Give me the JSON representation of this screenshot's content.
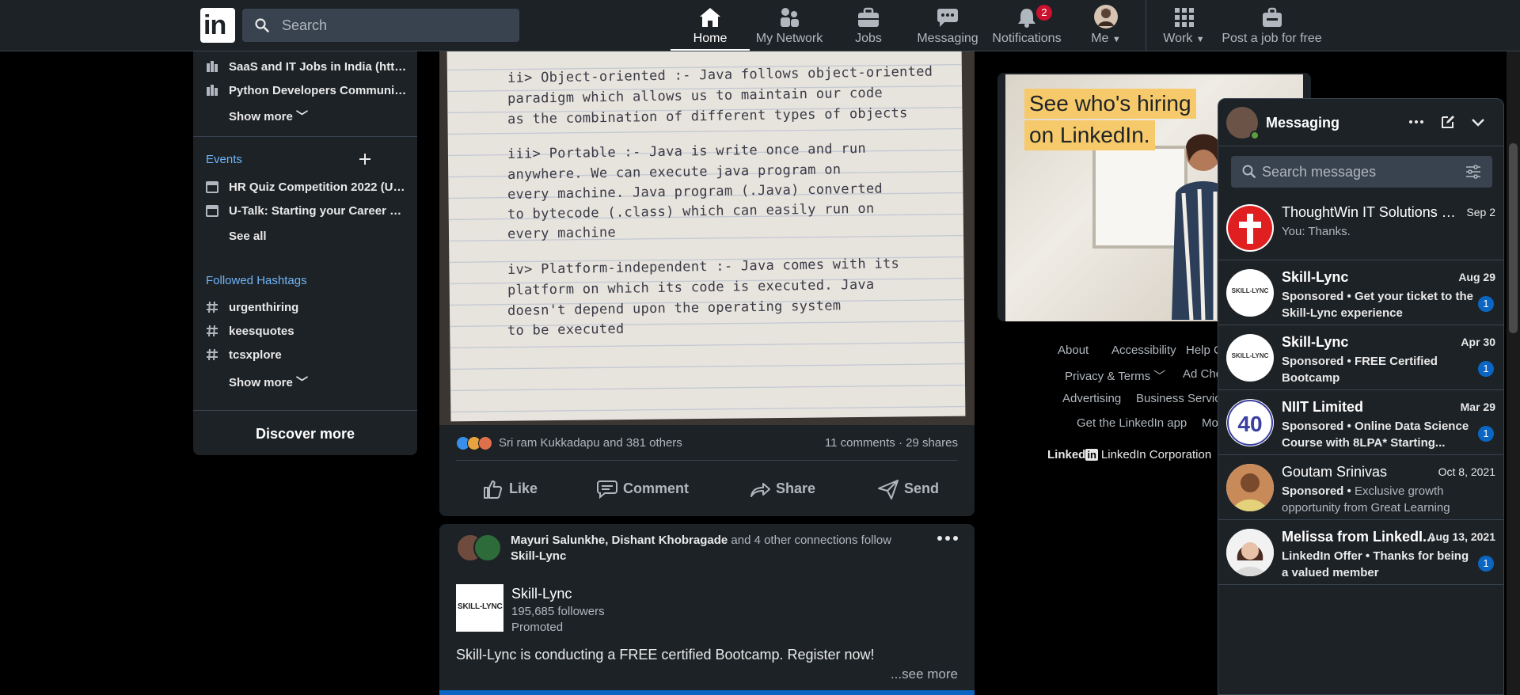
{
  "nav": {
    "logo_text": "in",
    "search_placeholder": "Search",
    "items": [
      {
        "label": "Home",
        "icon": "home-icon"
      },
      {
        "label": "My Network",
        "icon": "network-icon"
      },
      {
        "label": "Jobs",
        "icon": "briefcase-icon"
      },
      {
        "label": "Messaging",
        "icon": "chat-icon"
      },
      {
        "label": "Notifications",
        "icon": "bell-icon",
        "badge": "2"
      },
      {
        "label": "Me",
        "icon": "avatar"
      },
      {
        "label": "Work",
        "icon": "grid-icon"
      },
      {
        "label": "Post a job for free",
        "icon": "post-job-icon"
      }
    ]
  },
  "sidebar": {
    "groups": [
      {
        "label": "SaaS and IT Jobs in India (http..."
      },
      {
        "label": "Python Developers Communit..."
      }
    ],
    "groups_show_more": "Show more",
    "events_heading": "Events",
    "events": [
      {
        "label": "HR Quiz Competition 2022 (Us..."
      },
      {
        "label": "U-Talk: Starting your Career at ..."
      }
    ],
    "events_see_all": "See all",
    "hashtags_heading": "Followed Hashtags",
    "hashtags": [
      {
        "label": "urgenthiring"
      },
      {
        "label": "keesquotes"
      },
      {
        "label": "tcsxplore"
      }
    ],
    "hashtags_show_more": "Show more",
    "discover": "Discover more"
  },
  "post1": {
    "note_lines": [
      "ii> Object-oriented :- Java follows object-oriented",
      "paradigm which allows us to maintain our code",
      "as the combination of different types of objects",
      "iii> Portable :- Java is write once and run",
      "anywhere. We can execute java program on",
      "every machine. Java program (.Java) converted",
      "to bytecode (.class) which can easily run on",
      "every machine",
      "iv> Platform-independent :- Java comes with its",
      "platform on which its code is executed. Java",
      "doesn't depend upon the operating system",
      "to be executed"
    ],
    "reactions_text": "Sri ram Kukkadapu and 381 others",
    "stats_text": "11 comments · 29 shares",
    "actions": {
      "like": "Like",
      "comment": "Comment",
      "share": "Share",
      "send": "Send"
    }
  },
  "post2": {
    "connection_names": "Mayuri Salunkhe, Dishant Khobragade",
    "connection_rest": " and 4 other connections follow",
    "connection_company": "Skill-Lync",
    "logo_text": "SKILL-LYNC",
    "company": "Skill-Lync",
    "followers": "195,685 followers",
    "promoted": "Promoted",
    "text": "Skill-Lync is conducting a FREE certified Bootcamp. Register now!",
    "see_more": "...see more"
  },
  "ad": {
    "line1": "See who's hiring",
    "line2": "on LinkedIn."
  },
  "footer": {
    "links": [
      "About",
      "Accessibility",
      "Help C",
      "Privacy & Terms",
      "Ad Cho",
      "Advertising",
      "Business Service",
      "Get the LinkedIn app",
      "Mo"
    ],
    "brand_word": "Linked",
    "brand_in": "in",
    "corp": "LinkedIn Corporation"
  },
  "messaging": {
    "title": "Messaging",
    "search_placeholder": "Search messages",
    "conversations": [
      {
        "name": "ThoughtWin IT Solutions Pv...",
        "date": "Sep 2",
        "preview": "You: Thanks.",
        "sponsored": "",
        "unread": "",
        "bold": false
      },
      {
        "name": "Skill-Lync",
        "date": "Aug 29",
        "sponsored": "Sponsored •",
        "preview": "Get your ticket to the Skill-Lync experience",
        "unread": "1",
        "bold": true
      },
      {
        "name": "Skill-Lync",
        "date": "Apr 30",
        "sponsored": "Sponsored •",
        "preview": "FREE Certified Bootcamp",
        "unread": "1",
        "bold": true
      },
      {
        "name": "NIIT Limited",
        "date": "Mar 29",
        "sponsored": "Sponsored •",
        "preview": "Online Data Science Course with 8LPA* Starting...",
        "unread": "1",
        "bold": true
      },
      {
        "name": "Goutam Srinivas",
        "date": "Oct 8, 2021",
        "sponsored": "Sponsored •",
        "preview": "Exclusive growth opportunity from Great Learning",
        "unread": "",
        "bold": false
      },
      {
        "name": "Melissa from LinkedI...",
        "date": "Aug 13, 2021",
        "sponsored": "LinkedIn Offer •",
        "preview": "Thanks for being a valued member",
        "unread": "1",
        "bold": true
      }
    ],
    "avatar_text": {
      "skill_lync": "SKILL-LYNC",
      "niit": "40"
    }
  },
  "colors": {
    "nav_bg": "#1d2226",
    "accent": "#70b5f9",
    "badge": "#cb112d",
    "unread": "#0a66c2"
  }
}
